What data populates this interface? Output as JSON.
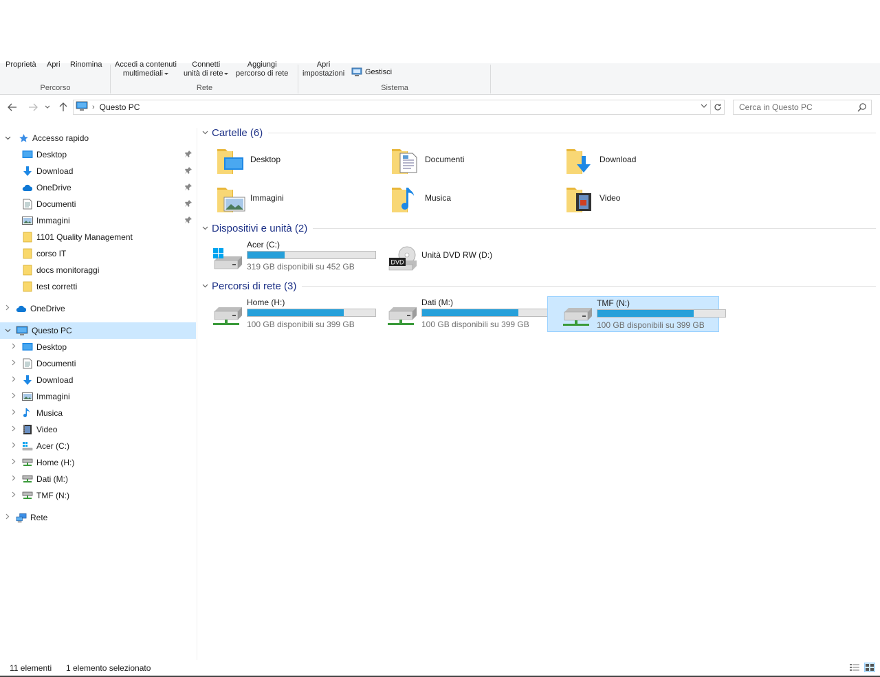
{
  "ribbon": {
    "percorso": {
      "buttons": [
        "Proprietà",
        "Apri",
        "Rinomina"
      ],
      "label": "Percorso"
    },
    "rete": {
      "accedi_line1": "Accedi a contenuti",
      "accedi_line2": "multimediali",
      "connetti_line1": "Connetti",
      "connetti_line2": "unità di rete",
      "aggiungi_line1": "Aggiungi",
      "aggiungi_line2": "percorso di rete",
      "label": "Rete"
    },
    "sistema": {
      "apri_line1": "Apri",
      "apri_line2": "impostazioni",
      "gestisci": "Gestisci",
      "label": "Sistema"
    }
  },
  "address": {
    "path": "Questo PC",
    "search_placeholder": "Cerca in Questo PC"
  },
  "sidebar": {
    "quick_access": "Accesso rapido",
    "quick_items": [
      {
        "label": "Desktop",
        "icon": "desktop-icon",
        "pinned": true
      },
      {
        "label": "Download",
        "icon": "download-icon",
        "pinned": true
      },
      {
        "label": "OneDrive",
        "icon": "onedrive-icon",
        "pinned": true
      },
      {
        "label": "Documenti",
        "icon": "documents-icon",
        "pinned": true
      },
      {
        "label": "Immagini",
        "icon": "pictures-icon",
        "pinned": true
      },
      {
        "label": "1101 Quality Management",
        "icon": "folder-icon",
        "pinned": false
      },
      {
        "label": "corso IT",
        "icon": "folder-icon",
        "pinned": false
      },
      {
        "label": "docs monitoraggi",
        "icon": "folder-icon",
        "pinned": false
      },
      {
        "label": "test corretti",
        "icon": "folder-icon",
        "pinned": false
      }
    ],
    "onedrive": "OneDrive",
    "this_pc": "Questo PC",
    "pc_items": [
      {
        "label": "Desktop",
        "icon": "desktop-icon"
      },
      {
        "label": "Documenti",
        "icon": "documents-icon"
      },
      {
        "label": "Download",
        "icon": "download-icon"
      },
      {
        "label": "Immagini",
        "icon": "pictures-icon"
      },
      {
        "label": "Musica",
        "icon": "music-icon"
      },
      {
        "label": "Video",
        "icon": "video-icon"
      },
      {
        "label": "Acer (C:)",
        "icon": "system-drive-icon"
      },
      {
        "label": "Home (H:)",
        "icon": "network-drive-icon"
      },
      {
        "label": "Dati (M:)",
        "icon": "network-drive-icon"
      },
      {
        "label": "TMF (N:)",
        "icon": "network-drive-icon"
      }
    ],
    "network": "Rete"
  },
  "content": {
    "folders_header": "Cartelle (6)",
    "folders": [
      {
        "label": "Desktop",
        "icon": "desktop-folder-icon"
      },
      {
        "label": "Documenti",
        "icon": "documents-folder-icon"
      },
      {
        "label": "Download",
        "icon": "download-folder-icon"
      },
      {
        "label": "Immagini",
        "icon": "pictures-folder-icon"
      },
      {
        "label": "Musica",
        "icon": "music-folder-icon"
      },
      {
        "label": "Video",
        "icon": "video-folder-icon"
      }
    ],
    "devices_header": "Dispositivi e unità (2)",
    "devices": [
      {
        "label": "Acer (C:)",
        "info": "319 GB disponibili su 452 GB",
        "used_fraction": 0.29,
        "icon": "system-drive-icon"
      },
      {
        "label": "Unità DVD RW (D:)",
        "info": "",
        "icon": "dvd-drive-icon"
      }
    ],
    "network_header": "Percorsi di rete (3)",
    "network_drives": [
      {
        "label": "Home (H:)",
        "info": "100 GB disponibili su 399 GB",
        "used_fraction": 0.75,
        "selected": false
      },
      {
        "label": "Dati (M:)",
        "info": "100 GB disponibili su 399 GB",
        "used_fraction": 0.75,
        "selected": false
      },
      {
        "label": "TMF (N:)",
        "info": "100 GB disponibili su 399 GB",
        "used_fraction": 0.75,
        "selected": true
      }
    ]
  },
  "status": {
    "count": "11 elementi",
    "selection": "1 elemento selezionato"
  },
  "colors": {
    "accent": "#26a0da",
    "selection": "#cce8ff",
    "header_text": "#1e3287"
  }
}
